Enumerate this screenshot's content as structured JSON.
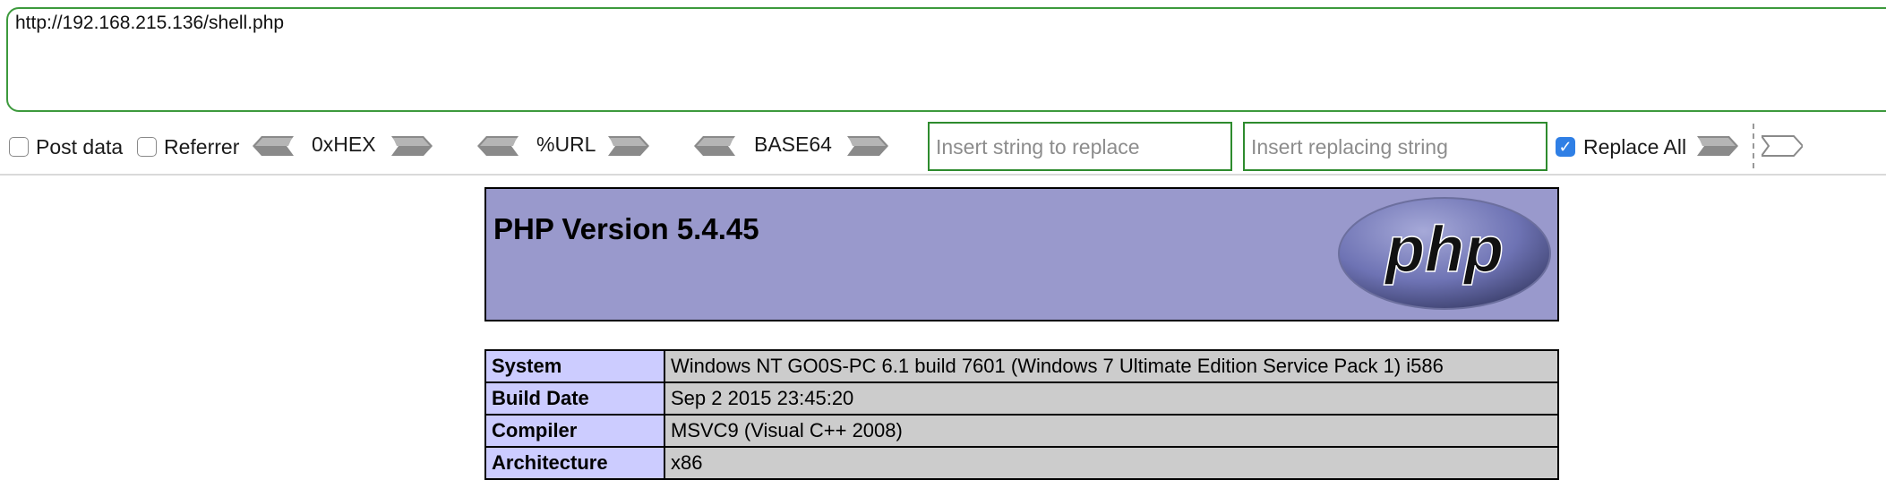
{
  "toolbar": {
    "url": "http://192.168.215.136/shell.php",
    "post_data_label": "Post data",
    "post_data_checked": false,
    "referrer_label": "Referrer",
    "referrer_checked": false,
    "hex_label": "0xHEX",
    "url_encode_label": "%URL",
    "base64_label": "BASE64",
    "replace_string_placeholder": "Insert string to replace",
    "replacing_string_placeholder": "Insert replacing string",
    "replace_all_label": "Replace All",
    "replace_all_checked": true,
    "accent_color": "#3d9a3d"
  },
  "phpinfo": {
    "title": "PHP Version 5.4.45",
    "logo_text": "php",
    "header_color": "#9999cc",
    "rows": [
      {
        "key": "System",
        "value": "Windows NT GO0S-PC 6.1 build 7601 (Windows 7 Ultimate Edition Service Pack 1) i586"
      },
      {
        "key": "Build Date",
        "value": "Sep 2 2015 23:45:20"
      },
      {
        "key": "Compiler",
        "value": "MSVC9 (Visual C++ 2008)"
      },
      {
        "key": "Architecture",
        "value": "x86"
      }
    ]
  }
}
